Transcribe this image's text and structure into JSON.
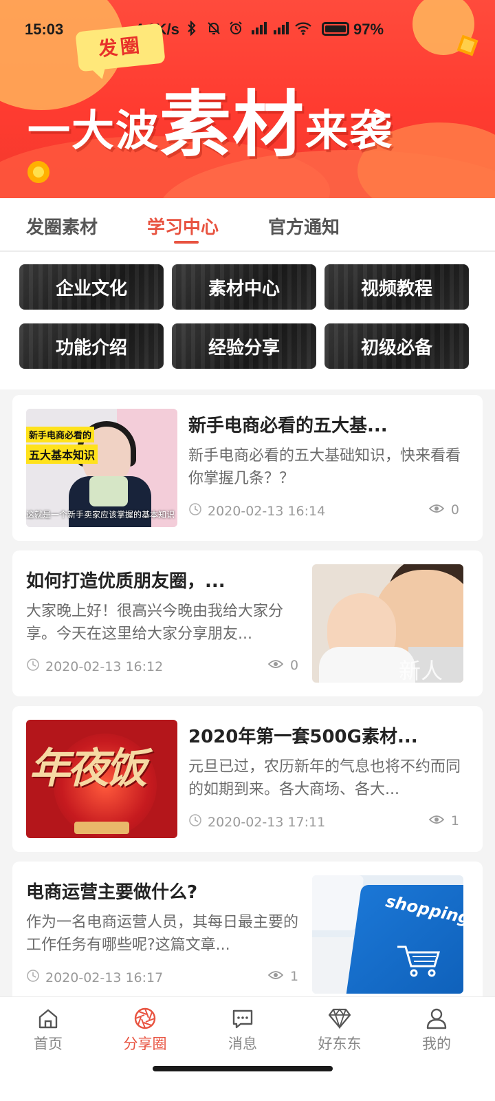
{
  "status_bar": {
    "time": "15:03",
    "speed": "4.0K/s",
    "battery": "97%",
    "icons": [
      "bluetooth-icon",
      "bell-off-icon",
      "alarm-icon",
      "signal-hd-icon",
      "signal-hd-icon",
      "wifi-icon",
      "battery-icon"
    ]
  },
  "banner": {
    "tag": "发圈",
    "headline_part1": "一大波",
    "headline_part2": "素材",
    "headline_part3": "来袭"
  },
  "tabs": [
    {
      "label": "发圈素材",
      "active": false
    },
    {
      "label": "学习中心",
      "active": true
    },
    {
      "label": "官方通知",
      "active": false
    }
  ],
  "categories": [
    {
      "label": "企业文化"
    },
    {
      "label": "素材中心"
    },
    {
      "label": "视频教程"
    },
    {
      "label": "功能介绍"
    },
    {
      "label": "经验分享"
    },
    {
      "label": "初级必备"
    }
  ],
  "articles": [
    {
      "title": "新手电商必看的五大基...",
      "desc": "新手电商必看的五大基础知识，快来看看你掌握几条？？",
      "date": "2020-02-13 16:14",
      "views": "0",
      "thumb_text_1": "新手电商必看的",
      "thumb_text_2": "五大基本知识",
      "thumb_sub": "这就是一个新手卖家应该掌握的基本知识"
    },
    {
      "title": "如何打造优质朋友圈，...",
      "desc": "大家晚上好！很高兴今晚由我给大家分享。今天在这里给大家分享朋友...",
      "date": "2020-02-13 16:12",
      "views": "0",
      "thumb_text": "新人"
    },
    {
      "title": "2020年第一套500G素材...",
      "desc": "元旦已过，农历新年的气息也将不约而同的如期到来。各大商场、各大...",
      "date": "2020-02-13 17:11",
      "views": "1",
      "thumb_text": "年夜饭"
    },
    {
      "title": "电商运营主要做什么?",
      "desc": "作为一名电商运营人员，其每日最主要的工作任务有哪些呢?这篇文章...",
      "date": "2020-02-13 16:17",
      "views": "1",
      "thumb_text": "shopping"
    }
  ],
  "bottom_nav": [
    {
      "label": "首页",
      "icon": "home-icon",
      "active": false
    },
    {
      "label": "分享圈",
      "icon": "aperture-icon",
      "active": true
    },
    {
      "label": "消息",
      "icon": "chat-icon",
      "active": false
    },
    {
      "label": "好东东",
      "icon": "diamond-icon",
      "active": false
    },
    {
      "label": "我的",
      "icon": "person-icon",
      "active": false
    }
  ],
  "colors": {
    "accent": "#e85340",
    "banner": "#ff3b30"
  }
}
